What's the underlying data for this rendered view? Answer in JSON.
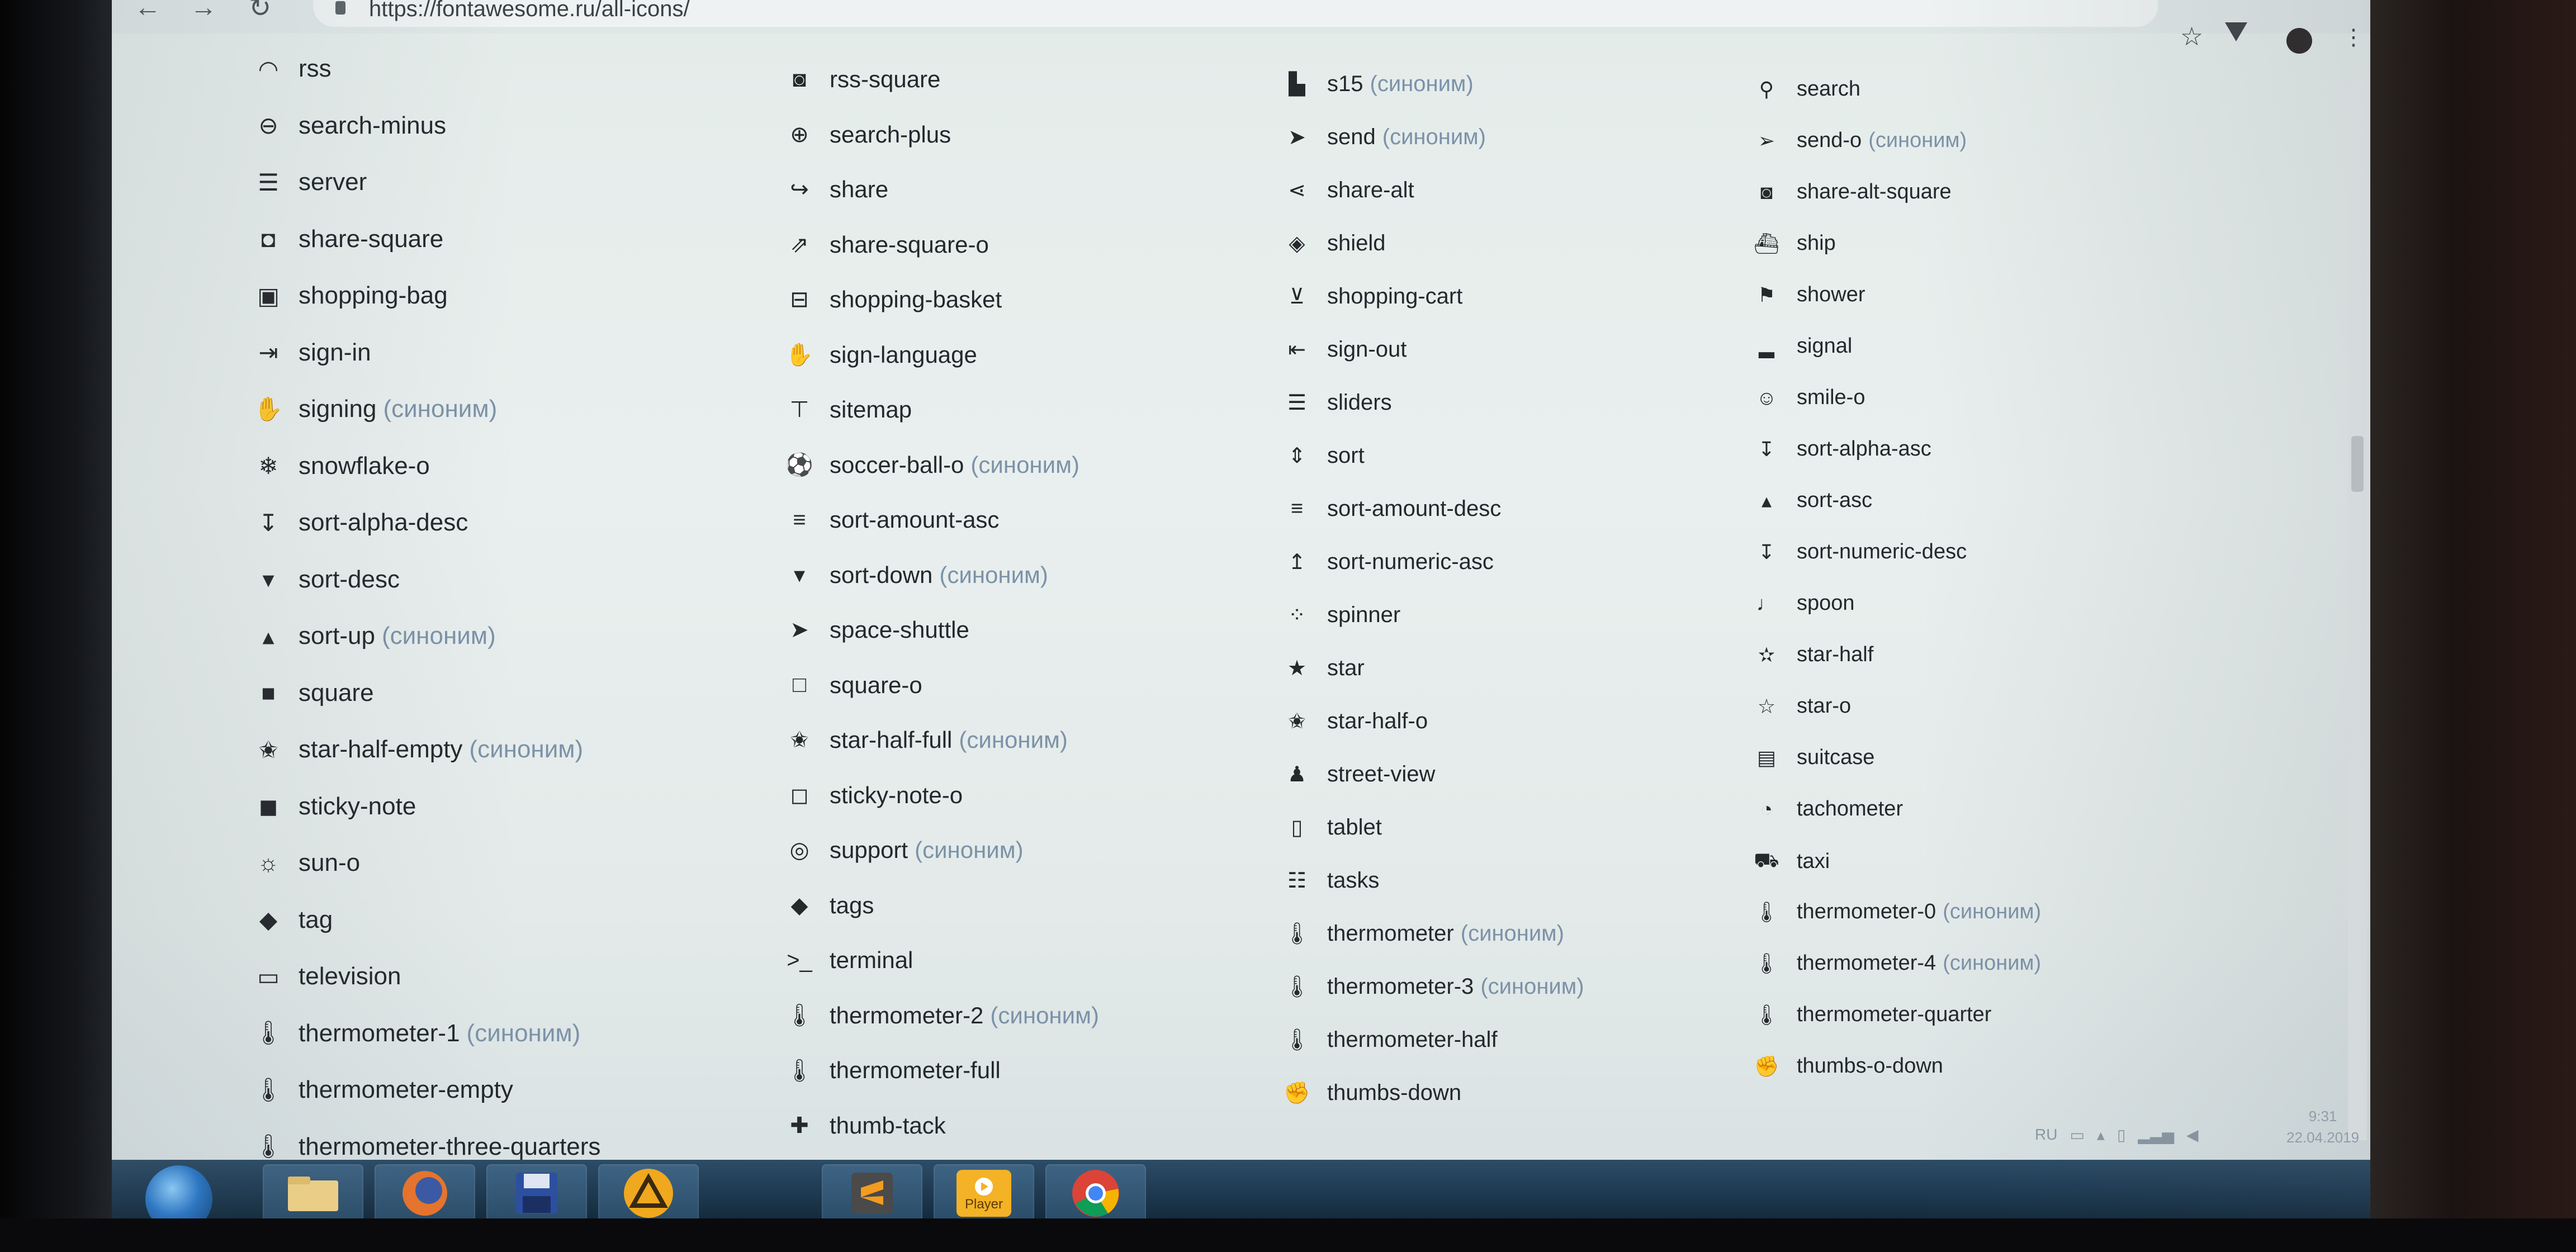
{
  "browser": {
    "url": "https://fontawesome.ru/all-icons/"
  },
  "columns": [
    {
      "items": [
        {
          "name": "rss",
          "icon": "rss-icon",
          "synonym": ""
        },
        {
          "name": "search-minus",
          "icon": "search-minus-icon",
          "synonym": ""
        },
        {
          "name": "server",
          "icon": "server-icon",
          "synonym": ""
        },
        {
          "name": "share-square",
          "icon": "share-square-icon",
          "synonym": ""
        },
        {
          "name": "shopping-bag",
          "icon": "shopping-bag-icon",
          "synonym": ""
        },
        {
          "name": "sign-in",
          "icon": "sign-in-icon",
          "synonym": ""
        },
        {
          "name": "signing",
          "icon": "signing-icon",
          "synonym": "(синоним)"
        },
        {
          "name": "snowflake-o",
          "icon": "snowflake-icon",
          "synonym": ""
        },
        {
          "name": "sort-alpha-desc",
          "icon": "sort-alpha-desc-icon",
          "synonym": ""
        },
        {
          "name": "sort-desc",
          "icon": "sort-desc-icon",
          "synonym": ""
        },
        {
          "name": "sort-up",
          "icon": "sort-up-icon",
          "synonym": "(синоним)"
        },
        {
          "name": "square",
          "icon": "square-icon",
          "synonym": ""
        },
        {
          "name": "star-half-empty",
          "icon": "star-half-empty-icon",
          "synonym": "(синоним)"
        },
        {
          "name": "sticky-note",
          "icon": "sticky-note-icon",
          "synonym": ""
        },
        {
          "name": "sun-o",
          "icon": "sun-icon",
          "synonym": ""
        },
        {
          "name": "tag",
          "icon": "tag-icon",
          "synonym": ""
        },
        {
          "name": "television",
          "icon": "television-icon",
          "synonym": ""
        },
        {
          "name": "thermometer-1",
          "icon": "thermometer-icon",
          "synonym": "(синоним)"
        },
        {
          "name": "thermometer-empty",
          "icon": "thermometer-icon",
          "synonym": ""
        },
        {
          "name": "thermometer-three-quarters",
          "icon": "thermometer-icon",
          "synonym": ""
        }
      ]
    },
    {
      "items": [
        {
          "name": "rss-square",
          "icon": "rss-square-icon",
          "synonym": ""
        },
        {
          "name": "search-plus",
          "icon": "search-plus-icon",
          "synonym": ""
        },
        {
          "name": "share",
          "icon": "share-icon",
          "synonym": ""
        },
        {
          "name": "share-square-o",
          "icon": "share-square-o-icon",
          "synonym": ""
        },
        {
          "name": "shopping-basket",
          "icon": "shopping-basket-icon",
          "synonym": ""
        },
        {
          "name": "sign-language",
          "icon": "sign-language-icon",
          "synonym": ""
        },
        {
          "name": "sitemap",
          "icon": "sitemap-icon",
          "synonym": ""
        },
        {
          "name": "soccer-ball-o",
          "icon": "soccer-ball-icon",
          "synonym": "(синоним)"
        },
        {
          "name": "sort-amount-asc",
          "icon": "sort-amount-asc-icon",
          "synonym": ""
        },
        {
          "name": "sort-down",
          "icon": "sort-down-icon",
          "synonym": "(синоним)"
        },
        {
          "name": "space-shuttle",
          "icon": "space-shuttle-icon",
          "synonym": ""
        },
        {
          "name": "square-o",
          "icon": "square-o-icon",
          "synonym": ""
        },
        {
          "name": "star-half-full",
          "icon": "star-half-full-icon",
          "synonym": "(синоним)"
        },
        {
          "name": "sticky-note-o",
          "icon": "sticky-note-o-icon",
          "synonym": ""
        },
        {
          "name": "support",
          "icon": "support-icon",
          "synonym": "(синоним)"
        },
        {
          "name": "tags",
          "icon": "tags-icon",
          "synonym": ""
        },
        {
          "name": "terminal",
          "icon": "terminal-icon",
          "synonym": ""
        },
        {
          "name": "thermometer-2",
          "icon": "thermometer-icon",
          "synonym": "(синоним)"
        },
        {
          "name": "thermometer-full",
          "icon": "thermometer-icon",
          "synonym": ""
        },
        {
          "name": "thumb-tack",
          "icon": "thumb-tack-icon",
          "synonym": ""
        }
      ]
    },
    {
      "items": [
        {
          "name": "s15",
          "icon": "s15-icon",
          "synonym": "(синоним)"
        },
        {
          "name": "send",
          "icon": "send-icon",
          "synonym": "(синоним)"
        },
        {
          "name": "share-alt",
          "icon": "share-alt-icon",
          "synonym": ""
        },
        {
          "name": "shield",
          "icon": "shield-icon",
          "synonym": ""
        },
        {
          "name": "shopping-cart",
          "icon": "shopping-cart-icon",
          "synonym": ""
        },
        {
          "name": "sign-out",
          "icon": "sign-out-icon",
          "synonym": ""
        },
        {
          "name": "sliders",
          "icon": "sliders-icon",
          "synonym": ""
        },
        {
          "name": "sort",
          "icon": "sort-icon",
          "synonym": ""
        },
        {
          "name": "sort-amount-desc",
          "icon": "sort-amount-desc-icon",
          "synonym": ""
        },
        {
          "name": "sort-numeric-asc",
          "icon": "sort-numeric-asc-icon",
          "synonym": ""
        },
        {
          "name": "spinner",
          "icon": "spinner-icon",
          "synonym": ""
        },
        {
          "name": "star",
          "icon": "star-icon",
          "synonym": ""
        },
        {
          "name": "star-half-o",
          "icon": "star-half-o-icon",
          "synonym": ""
        },
        {
          "name": "street-view",
          "icon": "street-view-icon",
          "synonym": ""
        },
        {
          "name": "tablet",
          "icon": "tablet-icon",
          "synonym": ""
        },
        {
          "name": "tasks",
          "icon": "tasks-icon",
          "synonym": ""
        },
        {
          "name": "thermometer",
          "icon": "thermometer-icon",
          "synonym": "(синоним)"
        },
        {
          "name": "thermometer-3",
          "icon": "thermometer-icon",
          "synonym": "(синоним)"
        },
        {
          "name": "thermometer-half",
          "icon": "thermometer-icon",
          "synonym": ""
        },
        {
          "name": "thumbs-down",
          "icon": "thumbs-down-icon",
          "synonym": ""
        }
      ]
    },
    {
      "items": [
        {
          "name": "search",
          "icon": "search-icon",
          "synonym": ""
        },
        {
          "name": "send-o",
          "icon": "send-o-icon",
          "synonym": "(синоним)"
        },
        {
          "name": "share-alt-square",
          "icon": "share-alt-square-icon",
          "synonym": ""
        },
        {
          "name": "ship",
          "icon": "ship-icon",
          "synonym": ""
        },
        {
          "name": "shower",
          "icon": "shower-icon",
          "synonym": ""
        },
        {
          "name": "signal",
          "icon": "signal-icon",
          "synonym": ""
        },
        {
          "name": "smile-o",
          "icon": "smile-icon",
          "synonym": ""
        },
        {
          "name": "sort-alpha-asc",
          "icon": "sort-alpha-asc-icon",
          "synonym": ""
        },
        {
          "name": "sort-asc",
          "icon": "sort-asc-icon",
          "synonym": ""
        },
        {
          "name": "sort-numeric-desc",
          "icon": "sort-numeric-desc-icon",
          "synonym": ""
        },
        {
          "name": "spoon",
          "icon": "spoon-icon",
          "synonym": ""
        },
        {
          "name": "star-half",
          "icon": "star-half-icon",
          "synonym": ""
        },
        {
          "name": "star-o",
          "icon": "star-o-icon",
          "synonym": ""
        },
        {
          "name": "suitcase",
          "icon": "suitcase-icon",
          "synonym": ""
        },
        {
          "name": "tachometer",
          "icon": "tachometer-icon",
          "synonym": ""
        },
        {
          "name": "taxi",
          "icon": "taxi-icon",
          "synonym": ""
        },
        {
          "name": "thermometer-0",
          "icon": "thermometer-icon",
          "synonym": "(синоним)"
        },
        {
          "name": "thermometer-4",
          "icon": "thermometer-icon",
          "synonym": "(синоним)"
        },
        {
          "name": "thermometer-quarter",
          "icon": "thermometer-icon",
          "synonym": ""
        },
        {
          "name": "thumbs-o-down",
          "icon": "thumbs-o-down-icon",
          "synonym": ""
        }
      ]
    }
  ],
  "taskbar": {
    "apps": [
      {
        "name": "start-button",
        "icon": "windows-start-icon"
      },
      {
        "name": "file-explorer",
        "icon": "folder-icon"
      },
      {
        "name": "firefox",
        "icon": "firefox-icon"
      },
      {
        "name": "save-app",
        "icon": "floppy-disk-icon"
      },
      {
        "name": "aimp",
        "icon": "aimp-icon"
      },
      {
        "name": "sublime-text",
        "icon": "sublime-text-icon"
      },
      {
        "name": "player",
        "icon": "player-icon",
        "label": "Player"
      },
      {
        "name": "chrome",
        "icon": "chrome-icon"
      }
    ]
  },
  "tray": {
    "language": "RU",
    "time": "9:31",
    "date": "22.04.2019"
  },
  "colors": {
    "synonym": "#7c92a8",
    "text": "#22282c",
    "taskbar": "#1e3a52"
  }
}
